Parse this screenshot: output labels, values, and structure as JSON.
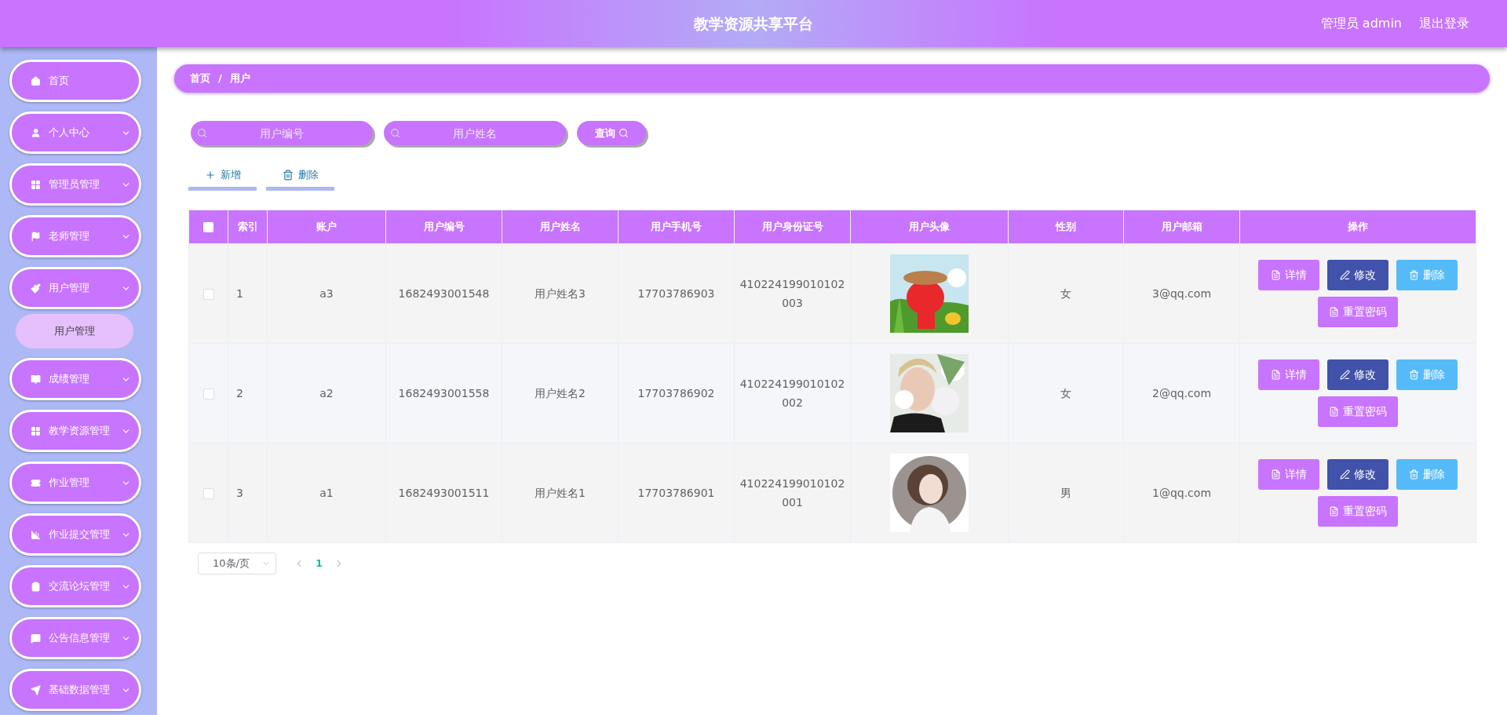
{
  "header": {
    "title": "教学资源共享平台",
    "user": "管理员 admin",
    "logout": "退出登录"
  },
  "sidebar": {
    "items": [
      {
        "label": "首页",
        "kind": "link"
      },
      {
        "label": "个人中心",
        "kind": "submenu"
      },
      {
        "label": "管理员管理",
        "kind": "submenu"
      },
      {
        "label": "老师管理",
        "kind": "submenu"
      },
      {
        "label": "用户管理",
        "kind": "submenu",
        "children": [
          {
            "label": "用户管理",
            "selected": true
          }
        ]
      },
      {
        "label": "成绩管理",
        "kind": "submenu"
      },
      {
        "label": "教学资源管理",
        "kind": "submenu"
      },
      {
        "label": "作业管理",
        "kind": "submenu"
      },
      {
        "label": "作业提交管理",
        "kind": "submenu"
      },
      {
        "label": "交流论坛管理",
        "kind": "submenu"
      },
      {
        "label": "公告信息管理",
        "kind": "submenu"
      },
      {
        "label": "基础数据管理",
        "kind": "submenu"
      }
    ]
  },
  "breadcrumb": [
    "首页",
    "/",
    "用户"
  ],
  "search": {
    "fields": [
      {
        "placeholder": "用户编号"
      },
      {
        "placeholder": "用户姓名"
      }
    ],
    "button": "查询"
  },
  "toolbar": [
    {
      "label": "新增",
      "kind": "add"
    },
    {
      "label": "删除",
      "kind": "delete"
    }
  ],
  "table": {
    "header_checked": false,
    "columns": [
      "索引",
      "账户",
      "用户编号",
      "用户姓名",
      "用户手机号",
      "用户身份证号",
      "用户头像",
      "性别",
      "用户邮箱",
      "操作"
    ],
    "rows": [
      {
        "checked": false,
        "index": "1",
        "account": "a3",
        "number": "1682493001548",
        "name": "用户姓名3",
        "phone": "17703786903",
        "id_card": [
          "410224199010102",
          "003"
        ],
        "gender": "女",
        "email": "3@qq.com",
        "actions": [
          {
            "label": "详情",
            "kind": "detail"
          },
          {
            "label": "修改",
            "kind": "edit"
          },
          {
            "label": "删除",
            "kind": "delete"
          },
          {
            "label": "重置密码",
            "kind": "reset"
          }
        ]
      },
      {
        "checked": false,
        "index": "2",
        "account": "a2",
        "number": "1682493001558",
        "name": "用户姓名2",
        "phone": "17703786902",
        "id_card": [
          "410224199010102",
          "002"
        ],
        "gender": "女",
        "email": "2@qq.com",
        "actions": [
          {
            "label": "详情",
            "kind": "detail"
          },
          {
            "label": "修改",
            "kind": "edit"
          },
          {
            "label": "删除",
            "kind": "delete"
          },
          {
            "label": "重置密码",
            "kind": "reset"
          }
        ]
      },
      {
        "checked": false,
        "index": "3",
        "account": "a1",
        "number": "1682493001511",
        "name": "用户姓名1",
        "phone": "17703786901",
        "id_card": [
          "410224199010102",
          "001"
        ],
        "gender": "男",
        "email": "1@qq.com",
        "actions": [
          {
            "label": "详情",
            "kind": "detail"
          },
          {
            "label": "修改",
            "kind": "edit"
          },
          {
            "label": "删除",
            "kind": "delete"
          },
          {
            "label": "重置密码",
            "kind": "reset"
          }
        ]
      }
    ]
  },
  "pagination": {
    "page_size": "10条/页",
    "pages": [
      {
        "label": "1",
        "selected": true
      }
    ]
  }
}
